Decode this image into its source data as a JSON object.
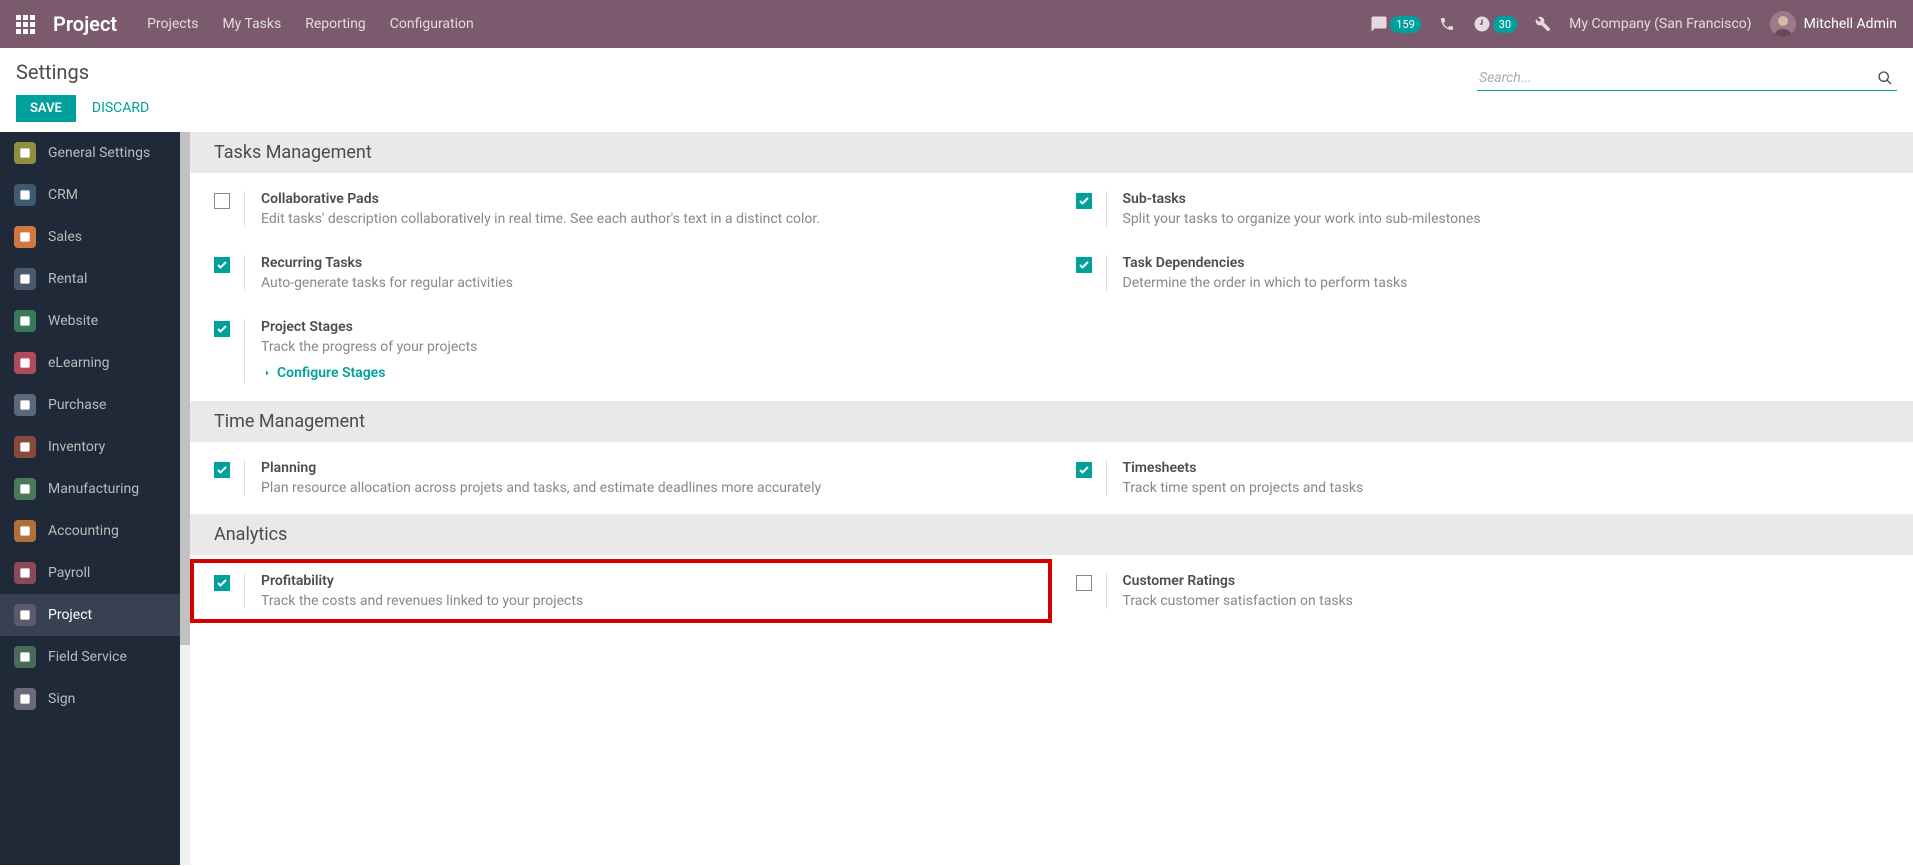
{
  "topbar": {
    "brand": "Project",
    "nav": [
      "Projects",
      "My Tasks",
      "Reporting",
      "Configuration"
    ],
    "messages_count": "159",
    "activities_count": "30",
    "company": "My Company (San Francisco)",
    "user": "Mitchell Admin"
  },
  "control_panel": {
    "title": "Settings",
    "save": "SAVE",
    "discard": "DISCARD",
    "search_placeholder": "Search..."
  },
  "sidebar": {
    "items": [
      {
        "label": "General Settings",
        "color": "#8f8f3f"
      },
      {
        "label": "CRM",
        "color": "#3e5a6e"
      },
      {
        "label": "Sales",
        "color": "#d17842"
      },
      {
        "label": "Rental",
        "color": "#4a5a6a"
      },
      {
        "label": "Website",
        "color": "#3a7a5a"
      },
      {
        "label": "eLearning",
        "color": "#b14a5a"
      },
      {
        "label": "Purchase",
        "color": "#5a6a7a"
      },
      {
        "label": "Inventory",
        "color": "#8a4a3a"
      },
      {
        "label": "Manufacturing",
        "color": "#4a7a5a"
      },
      {
        "label": "Accounting",
        "color": "#b1703a"
      },
      {
        "label": "Payroll",
        "color": "#8a4a5a"
      },
      {
        "label": "Project",
        "color": "#5a5a6a"
      },
      {
        "label": "Field Service",
        "color": "#4a6a5a"
      },
      {
        "label": "Sign",
        "color": "#6a6a7a"
      }
    ],
    "active_index": 11
  },
  "sections": [
    {
      "title": "Tasks Management",
      "settings": [
        {
          "title": "Collaborative Pads",
          "desc": "Edit tasks' description collaboratively in real time. See each author's text in a distinct color.",
          "checked": false
        },
        {
          "title": "Sub-tasks",
          "desc": "Split your tasks to organize your work into sub-milestones",
          "checked": true
        },
        {
          "title": "Recurring Tasks",
          "desc": "Auto-generate tasks for regular activities",
          "checked": true
        },
        {
          "title": "Task Dependencies",
          "desc": "Determine the order in which to perform tasks",
          "checked": true
        },
        {
          "title": "Project Stages",
          "desc": "Track the progress of your projects",
          "checked": true,
          "link": "Configure Stages",
          "fullrow": true
        }
      ]
    },
    {
      "title": "Time Management",
      "settings": [
        {
          "title": "Planning",
          "desc": "Plan resource allocation across projets and tasks, and estimate deadlines more accurately",
          "checked": true
        },
        {
          "title": "Timesheets",
          "desc": "Track time spent on projects and tasks",
          "checked": true
        }
      ]
    },
    {
      "title": "Analytics",
      "settings": [
        {
          "title": "Profitability",
          "desc": "Track the costs and revenues linked to your projects",
          "checked": true,
          "highlighted": true
        },
        {
          "title": "Customer Ratings",
          "desc": "Track customer satisfaction on tasks",
          "checked": false
        }
      ]
    }
  ]
}
